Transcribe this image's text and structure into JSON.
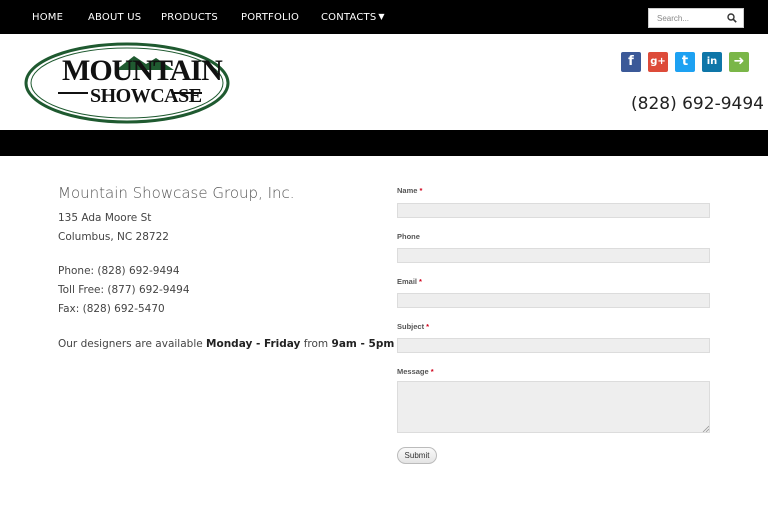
{
  "nav": {
    "items": [
      {
        "label": "HOME"
      },
      {
        "label": "ABOUT US"
      },
      {
        "label": "PRODUCTS"
      },
      {
        "label": "PORTFOLIO"
      },
      {
        "label": "CONTACTS"
      }
    ],
    "search_placeholder": "Search..."
  },
  "header": {
    "logo_line1": "MOUNTAIN",
    "logo_line2": "SHOWCASE",
    "phone": "(828) 692-9494",
    "social": [
      {
        "glyph": "f",
        "icon": "facebook-icon",
        "color": "#3b5998"
      },
      {
        "glyph": "g+",
        "icon": "google-plus-icon",
        "color": "#dd4b39"
      },
      {
        "glyph": "t",
        "icon": "twitter-icon",
        "color": "#1da1f2"
      },
      {
        "glyph": "in",
        "icon": "linkedin-icon",
        "color": "#0e76a8"
      },
      {
        "glyph": "➜",
        "icon": "share-icon",
        "color": "#7ab648"
      }
    ]
  },
  "contact": {
    "company": "Mountain Showcase Group, Inc.",
    "address1": "135 Ada Moore St",
    "address2": "Columbus, NC 28722",
    "phone": "Phone: (828) 692-9494",
    "tollfree": "Toll Free: (877) 692-9494",
    "fax": "Fax: (828) 692-5470",
    "avail_prefix": "Our designers are available ",
    "avail_days": "Monday - Friday",
    "avail_mid": " from ",
    "avail_hours": "9am - 5pm"
  },
  "form": {
    "name_label": "Name",
    "phone_label": "Phone",
    "email_label": "Email",
    "subject_label": "Subject",
    "message_label": "Message",
    "required_mark": "*",
    "submit_label": "Submit"
  },
  "colors": {
    "nav_bg": "#000000",
    "logo_ring": "#1f5a30",
    "required": "#d0021b"
  }
}
